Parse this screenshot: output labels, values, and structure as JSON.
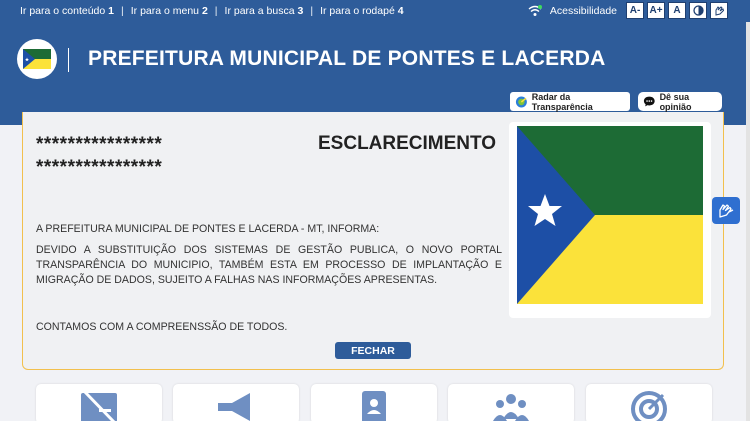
{
  "skip_links": [
    {
      "label": "Ir para o conteúdo",
      "key": "1"
    },
    {
      "label": "Ir para o menu",
      "key": "2"
    },
    {
      "label": "Ir para a busca",
      "key": "3"
    },
    {
      "label": "Ir para o rodapé",
      "key": "4"
    }
  ],
  "accessibility": {
    "label": "Acessibilidade",
    "buttons": [
      "A-",
      "A+",
      "A"
    ]
  },
  "header": {
    "title": "PREFEITURA MUNICIPAL DE PONTES E LACERDA",
    "radar_label": "Radar da Transparência",
    "opiniao_label": "Dê sua opinião"
  },
  "notice": {
    "masked_line_1": "****************",
    "masked_line_2": "****************",
    "title": "ESCLARECIMENTO",
    "paragraph_1": "A PREFEITURA MUNICIPAL DE PONTES E LACERDA - MT, INFORMA:",
    "paragraph_2": "DEVIDO A SUBSTITUIÇÃO DOS SISTEMAS DE GESTÃO PUBLICA, O NOVO PORTAL TRANSPARÊNCIA DO MUNICIPIO, TAMBÉM ESTA EM PROCESSO DE IMPLANTAÇÃO E MIGRAÇÃO DE DADOS, SUJEITO A FALHAS NAS INFORMAÇÕES APRESENTAS.",
    "paragraph_3": "CONTAMOS COM A COMPREENSSÃO DE TODOS.",
    "close_label": "FECHAR"
  },
  "colors": {
    "primary": "#2e5c9a",
    "accent_border": "#f2c04d",
    "flag_green": "#1d6b35",
    "flag_yellow": "#fbe23a",
    "flag_blue": "#1d4fa6",
    "libras_blue": "#2f6fd0",
    "service_icon": "#6f8fc2"
  },
  "icons": {
    "header_logo": "municipal-flag-icon",
    "status": "wifi-icon",
    "contrast": "contrast-icon",
    "libras": "sign-language-icon",
    "services": [
      "no-bill-icon",
      "megaphone-icon",
      "contacts-icon",
      "people-group-icon",
      "target-icon"
    ]
  }
}
